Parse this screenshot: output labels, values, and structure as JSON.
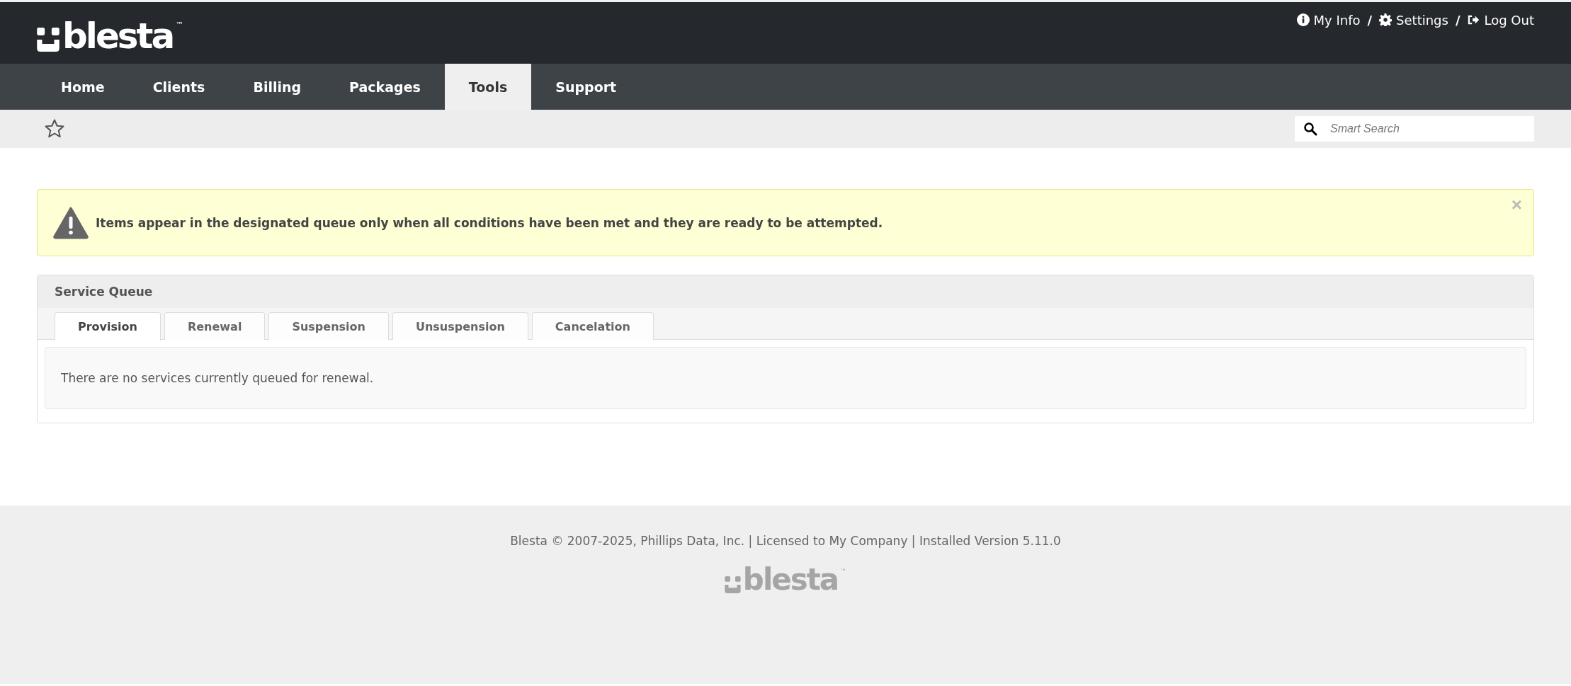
{
  "header": {
    "logo": {
      "text": "blesta",
      "mark": "™"
    },
    "links": [
      {
        "kind": "info",
        "label": "My Info"
      },
      {
        "kind": "settings",
        "label": "Settings"
      },
      {
        "kind": "logout",
        "label": "Log Out"
      }
    ],
    "separator": "/"
  },
  "nav": [
    {
      "label": "Home",
      "selected": false
    },
    {
      "label": "Clients",
      "selected": false
    },
    {
      "label": "Billing",
      "selected": false
    },
    {
      "label": "Packages",
      "selected": false
    },
    {
      "label": "Tools",
      "selected": true
    },
    {
      "label": "Support",
      "selected": false
    }
  ],
  "search": {
    "placeholder": "Smart Search"
  },
  "alert": {
    "message": "Items appear in the designated queue only when all conditions have been met and they are ready to be attempted.",
    "close": "×"
  },
  "panel": {
    "title": "Service Queue",
    "tabs": [
      {
        "label": "Provision",
        "selected": true
      },
      {
        "label": "Renewal",
        "selected": false
      },
      {
        "label": "Suspension",
        "selected": false
      },
      {
        "label": "Unsuspension",
        "selected": false
      },
      {
        "label": "Cancelation",
        "selected": false
      }
    ],
    "message": "There are no services currently queued for renewal."
  },
  "footer": {
    "text": "Blesta © 2007-2025, Phillips Data, Inc. | Licensed to My Company | Installed Version 5.11.0",
    "logo": {
      "text": "blesta",
      "mark": "™"
    }
  }
}
